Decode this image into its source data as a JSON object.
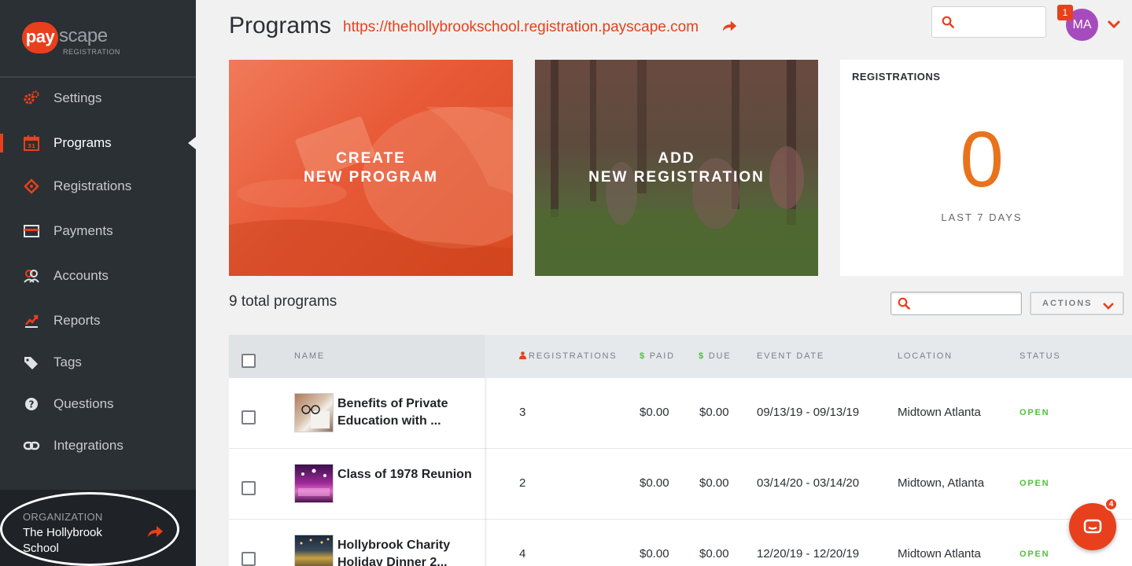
{
  "brand": {
    "logo_badge": "pay",
    "logo_word": "scape",
    "logo_sub": "REGISTRATION",
    "accent": "#e8401c",
    "sidebar_bg": "#2b3035"
  },
  "sidebar": {
    "items": [
      {
        "label": "Settings",
        "icon": "gears-icon",
        "active": false
      },
      {
        "label": "Programs",
        "icon": "calendar-icon",
        "active": true
      },
      {
        "label": "Registrations",
        "icon": "tag-diamond-icon",
        "active": false
      },
      {
        "label": "Payments",
        "icon": "card-icon",
        "active": false
      },
      {
        "label": "Accounts",
        "icon": "users-icon",
        "active": false
      },
      {
        "label": "Reports",
        "icon": "chart-icon",
        "active": false
      },
      {
        "label": "Tags",
        "icon": "tags-icon",
        "active": false
      },
      {
        "label": "Questions",
        "icon": "question-icon",
        "active": false
      },
      {
        "label": "Integrations",
        "icon": "link-icon",
        "active": false
      }
    ],
    "organization": {
      "label": "ORGANIZATION",
      "name": "The Hollybrook School"
    }
  },
  "header": {
    "title": "Programs",
    "url": "https://thehollybrookschool.registration.payscape.com",
    "search_placeholder": "",
    "notifications": "1",
    "avatar_initials": "MA",
    "avatar_color": "#a64bbd"
  },
  "cards": {
    "create": {
      "line1": "CREATE",
      "line2": "NEW PROGRAM"
    },
    "add": {
      "line1": "ADD",
      "line2": "NEW REGISTRATION"
    },
    "registrations": {
      "title": "REGISTRATIONS",
      "count": "0",
      "period": "LAST 7 DAYS"
    }
  },
  "list": {
    "total": "9 total programs",
    "search_placeholder": "",
    "actions_label": "ACTIONS"
  },
  "table": {
    "headers": {
      "name": "NAME",
      "registrations": "REGISTRATIONS",
      "paid": "PAID",
      "due": "DUE",
      "event_date": "EVENT DATE",
      "location": "LOCATION",
      "status": "STATUS",
      "currency": "$"
    },
    "rows": [
      {
        "name": "Benefits of Private Education with ...",
        "registrations": "3",
        "paid": "$0.00",
        "due": "$0.00",
        "event_date": "09/13/19 - 09/13/19",
        "location": "Midtown Atlanta",
        "status": "OPEN"
      },
      {
        "name": "Class of 1978 Reunion",
        "registrations": "2",
        "paid": "$0.00",
        "due": "$0.00",
        "event_date": "03/14/20 - 03/14/20",
        "location": "Midtown, Atlanta",
        "status": "OPEN"
      },
      {
        "name": "Hollybrook Charity Holiday Dinner 2...",
        "registrations": "4",
        "paid": "$0.00",
        "due": "$0.00",
        "event_date": "12/20/19 - 12/20/19",
        "location": "Midtown Atlanta",
        "status": "OPEN"
      }
    ]
  },
  "chat": {
    "badge": "4"
  }
}
